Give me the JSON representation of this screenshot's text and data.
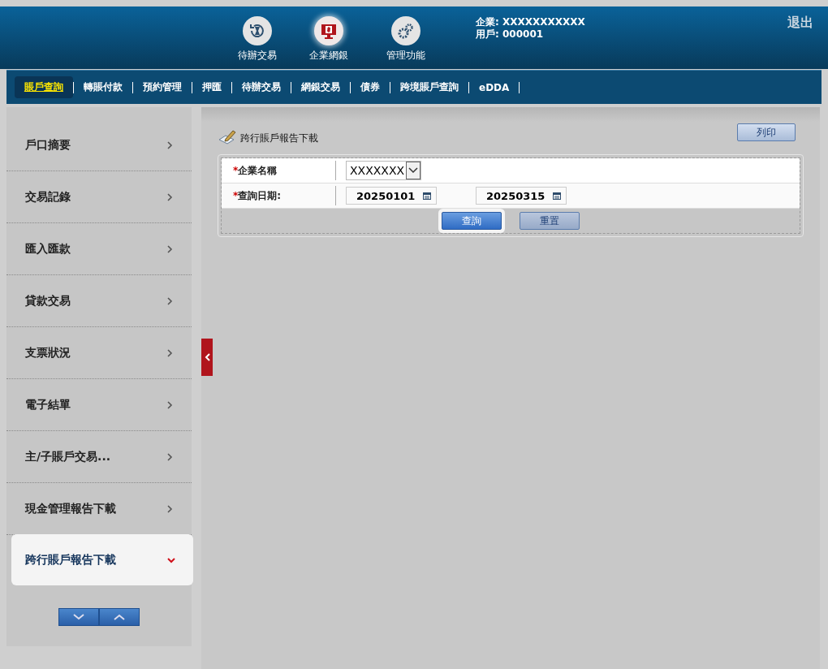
{
  "header": {
    "shortcuts": [
      {
        "label": "待辦交易",
        "kind": "hourglass",
        "selected": false
      },
      {
        "label": "企業網銀",
        "kind": "monitor",
        "selected": true
      },
      {
        "label": "管理功能",
        "kind": "gears",
        "selected": false
      }
    ],
    "company": "企業: XXXXXXXXXXX",
    "user": "用戶: 000001",
    "logout": "退出"
  },
  "nav": [
    {
      "label": "賬戶查詢",
      "selected": true
    },
    {
      "label": "轉賬付款",
      "selected": false
    },
    {
      "label": "預約管理",
      "selected": false
    },
    {
      "label": "押匯",
      "selected": false
    },
    {
      "label": "待辦交易",
      "selected": false
    },
    {
      "label": "網銀交易",
      "selected": false
    },
    {
      "label": "債券",
      "selected": false
    },
    {
      "label": "跨境賬戶查詢",
      "selected": false
    },
    {
      "label": "eDDA",
      "selected": false
    }
  ],
  "sidebar": {
    "items": [
      {
        "label": "戶口摘要",
        "selected": false
      },
      {
        "label": "交易記錄",
        "selected": false
      },
      {
        "label": "匯入匯款",
        "selected": false
      },
      {
        "label": "貸款交易",
        "selected": false
      },
      {
        "label": "支票狀況",
        "selected": false
      },
      {
        "label": "電子結單",
        "selected": false
      },
      {
        "label": "主/子賬戶交易...",
        "selected": false
      },
      {
        "label": "現金管理報告下載",
        "selected": false
      },
      {
        "label": "跨行賬戶報告下載",
        "selected": true
      }
    ]
  },
  "page": {
    "title": "跨行賬戶報告下載",
    "print": "列印",
    "form": {
      "company_label": "企業名稱",
      "company_value": "XXXXXXX",
      "date_label": "查詢日期:",
      "date_from": "20250101",
      "date_to": "20250315",
      "required_mark": "*"
    },
    "buttons": [
      {
        "label": "查詢",
        "selected": true
      },
      {
        "label": "重置",
        "selected": false
      }
    ]
  }
}
